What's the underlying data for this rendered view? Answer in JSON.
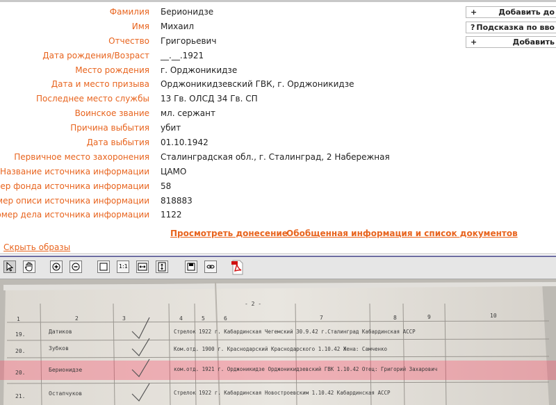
{
  "record": {
    "rows": [
      {
        "label": "Фамилия",
        "value": "Берионидзе"
      },
      {
        "label": "Имя",
        "value": "Михаил"
      },
      {
        "label": "Отчество",
        "value": "Григорьевич"
      },
      {
        "label": "Дата рождения/Возраст",
        "value": "__.__.1921"
      },
      {
        "label": "Место рождения",
        "value": "г. Орджоникидзе"
      },
      {
        "label": "Дата и место призыва",
        "value": "Орджоникидзевский ГВК, г. Орджоникидзе"
      },
      {
        "label": "Последнее место службы",
        "value": "13 Гв. ОЛСД 34 Гв. СП"
      },
      {
        "label": "Воинское звание",
        "value": "мл. сержант"
      },
      {
        "label": "Причина выбытия",
        "value": "убит"
      },
      {
        "label": "Дата выбытия",
        "value": "01.10.1942"
      },
      {
        "label": "Первичное место захоронения",
        "value": "Сталинградская обл., г. Сталинград, 2 Набережная"
      },
      {
        "label": "Название источника информации",
        "value": "ЦАМО"
      },
      {
        "label": "Номер фонда источника информации",
        "value": "58"
      },
      {
        "label": "Номер описи источника информации",
        "value": "818883"
      },
      {
        "label": "Номер дела источника информации",
        "value": "1122"
      }
    ]
  },
  "side_buttons": [
    {
      "symbol": "+",
      "label": "Добавить до"
    },
    {
      "symbol": "?",
      "label": "Подсказка по вво"
    },
    {
      "symbol": "+",
      "label": "Добавить"
    }
  ],
  "links": {
    "report": "Просмотреть донесение",
    "summary": "Обобщенная информация и список документов",
    "hide_images": "Скрыть образы"
  },
  "toolbar": {
    "tools": [
      "select-arrow-icon",
      "hand-pan-icon",
      "zoom-in-icon",
      "zoom-out-icon",
      "fit-page-icon",
      "actual-size-icon",
      "fit-width-icon",
      "fit-height-icon",
      "save-icon",
      "link-icon",
      "pdf-icon"
    ],
    "actual_size_label": "1:1"
  },
  "document_image": {
    "column_numbers": [
      "1",
      "2",
      "3",
      "4",
      "5",
      "6",
      "7",
      "8",
      "9",
      "10"
    ],
    "header_mark": "- 2 -",
    "rows": [
      {
        "num": "19.",
        "name": "Датиков",
        "text": "Стрелок  1922 г. Кабардинская Чегемский  30.9.42  г.Сталинград  Кабардинская АССР"
      },
      {
        "num": "20.",
        "name": "Зубков",
        "text": "Ком.отд.  1900 г. Краснодарский  Краснодарского  1.10.42  Жена: Самченко"
      },
      {
        "num": "20.",
        "name": "Берионидзе",
        "text": "ком.отд.  1921 г. Орджоникидзе  Орджоникидзевский ГВК  1.10.42  Отец: Григорий Захарович"
      },
      {
        "num": "21.",
        "name": "Остапчуков",
        "text": "Стрелок  1922 г. Кабардинская  Новостроевским  1.10.42  Кабардинская АССР"
      }
    ]
  },
  "colors": {
    "label": "#e8641e",
    "value": "#222222",
    "highlight": "#ff4060"
  }
}
